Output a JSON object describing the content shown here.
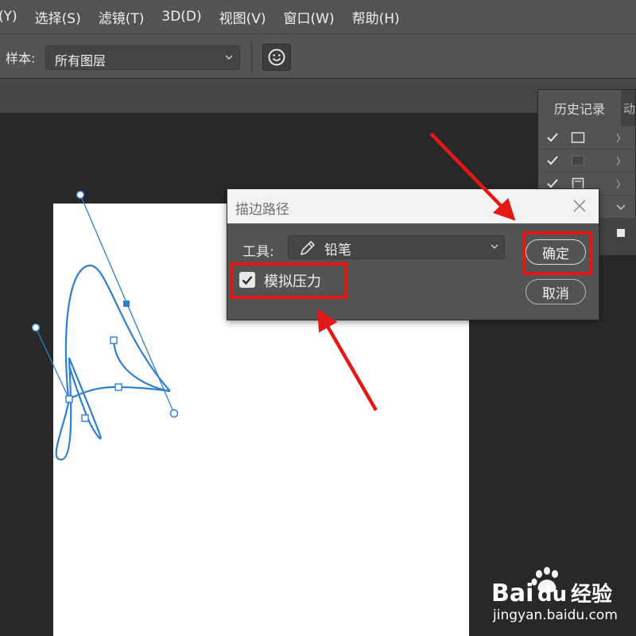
{
  "menu": {
    "items": [
      {
        "label": "(Y)"
      },
      {
        "label": "选择(S)"
      },
      {
        "label": "滤镜(T)"
      },
      {
        "label": "3D(D)"
      },
      {
        "label": "视图(V)"
      },
      {
        "label": "窗口(W)"
      },
      {
        "label": "帮助(H)"
      }
    ]
  },
  "options_bar": {
    "sample_label": "样本:",
    "sample_value": "所有图层",
    "target_icon": "smiley-target-icon"
  },
  "history_panel": {
    "tab_active": "历史记录",
    "tab_second": "动",
    "rows": [
      {
        "checked": true,
        "icon": "rect-icon"
      },
      {
        "checked": true,
        "icon": "layer-icon"
      },
      {
        "checked": true,
        "icon": "doc-icon"
      }
    ]
  },
  "dialog": {
    "title": "描边路径",
    "tool_label": "工具:",
    "tool_value": "铅笔",
    "simulate_pressure_label": "模拟压力",
    "simulate_pressure_checked": true,
    "ok_label": "确定",
    "cancel_label": "取消"
  },
  "annotation": {
    "color": "#e51818"
  },
  "watermark": {
    "logo_text": "Baidu经验",
    "url": "jingyan.baidu.com"
  },
  "colors": {
    "path_stroke": "#2f7fd0",
    "accent_red": "#e51818",
    "panel_bg": "#535353",
    "canvas_bg": "#282828"
  }
}
